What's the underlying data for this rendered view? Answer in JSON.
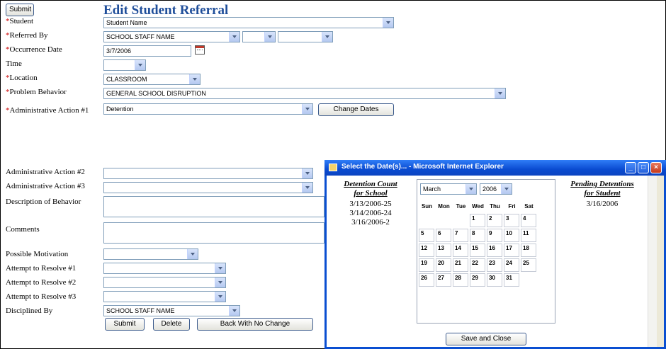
{
  "page": {
    "title": "Edit Student Referral",
    "top_submit": "Submit"
  },
  "form": {
    "student": {
      "label": "Student",
      "value": "Student Name"
    },
    "referred_by": {
      "label": "Referred By",
      "value": "SCHOOL STAFF NAME"
    },
    "occurrence_date": {
      "label": "Occurrence Date",
      "value": "3/7/2006"
    },
    "time": {
      "label": "Time"
    },
    "location": {
      "label": "Location",
      "value": "CLASSROOM"
    },
    "problem_behavior": {
      "label": "Problem Behavior",
      "value": "GENERAL SCHOOL DISRUPTION"
    },
    "admin_action_1": {
      "label": "Administrative Action #1",
      "value": "Detention",
      "change_dates": "Change Dates"
    },
    "admin_action_2": {
      "label": "Administrative Action #2"
    },
    "admin_action_3": {
      "label": "Administrative Action #3"
    },
    "description": {
      "label": "Description of Behavior"
    },
    "comments": {
      "label": "Comments"
    },
    "motivation": {
      "label": "Possible Motivation"
    },
    "resolve_1": {
      "label": "Attempt to Resolve #1"
    },
    "resolve_2": {
      "label": "Attempt to Resolve #2"
    },
    "resolve_3": {
      "label": "Attempt to Resolve #3"
    },
    "disciplined_by": {
      "label": "Disciplined By",
      "value": "SCHOOL STAFF NAME"
    },
    "required_marker": "*"
  },
  "buttons": {
    "submit": "Submit",
    "delete": "Delete",
    "back": "Back With No Change"
  },
  "popup": {
    "title": "Select the Date(s)... - Microsoft Internet Explorer",
    "left_heading_1": "Detention Count",
    "left_heading_2": "for School",
    "detention_counts": [
      "3/13/2006-25",
      "3/14/2006-24",
      "3/16/2006-2"
    ],
    "right_heading_1": "Pending Detentions",
    "right_heading_2": "for Student",
    "pending": [
      "3/16/2006"
    ],
    "month": "March",
    "year": "2006",
    "weekdays": [
      "Sun",
      "Mon",
      "Tue",
      "Wed",
      "Thu",
      "Fri",
      "Sat"
    ],
    "weeks": [
      [
        "",
        "",
        "",
        "1",
        "2",
        "3",
        "4"
      ],
      [
        "5",
        "6",
        "7",
        "8",
        "9",
        "10",
        "11"
      ],
      [
        "12",
        "13",
        "14",
        "15",
        "16",
        "17",
        "18"
      ],
      [
        "19",
        "20",
        "21",
        "22",
        "23",
        "24",
        "25"
      ],
      [
        "26",
        "27",
        "28",
        "29",
        "30",
        "31",
        ""
      ]
    ],
    "save_close": "Save and Close"
  },
  "colors": {
    "title": "#1f4e9a",
    "required": "#cc0000",
    "titlebar": "#0a4bd1"
  }
}
